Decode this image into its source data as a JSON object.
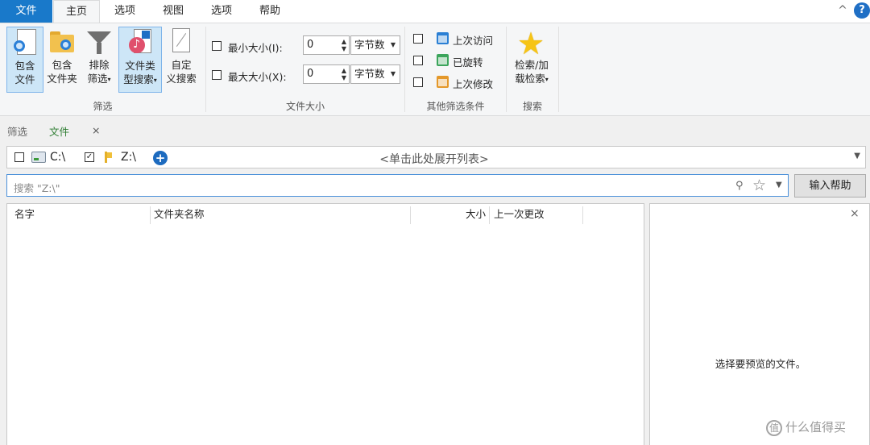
{
  "menu": {
    "file": "文件",
    "tabs": [
      "主页",
      "选项",
      "视图",
      "选项",
      "帮助"
    ],
    "collapse_glyph": "^",
    "help_glyph": "?"
  },
  "ribbon": {
    "filter_group": {
      "label": "筛选",
      "buttons": [
        {
          "line1": "包含",
          "line2": "文件",
          "icon": "document-search-icon"
        },
        {
          "line1": "包含",
          "line2": "文件夹",
          "icon": "folder-search-icon"
        },
        {
          "line1": "排除",
          "line2": "筛选",
          "icon": "funnel-icon"
        },
        {
          "line1": "文件类",
          "line2": "型搜索",
          "icon": "music-file-icon"
        },
        {
          "line1": "自定",
          "line2": "义搜索",
          "icon": "blank-document-icon"
        }
      ]
    },
    "size_group": {
      "label": "文件大小",
      "min_label": "最小大小(I):",
      "max_label": "最大大小(X):",
      "min_value": "0",
      "max_value": "0",
      "unit": "字节数"
    },
    "other_group": {
      "label": "其他筛选条件",
      "items": [
        "上次访问",
        "已旋转",
        "上次修改"
      ]
    },
    "search_group": {
      "label": "搜索",
      "line1": "检索/加",
      "line2": "载检索"
    }
  },
  "filter_tabs": {
    "filter": "筛选",
    "file": "文件",
    "close": "×"
  },
  "path_bar": {
    "drive_c": "C:\\",
    "drive_z": "Z:\\",
    "drive_c_checked": false,
    "drive_z_checked": true,
    "expand_text": "<单击此处展开列表>"
  },
  "search": {
    "placeholder": "搜索 \"Z:\\\"",
    "help_button": "输入帮助"
  },
  "results": {
    "columns": [
      "名字",
      "文件夹名称",
      "大小",
      "上一次更改"
    ]
  },
  "preview": {
    "close": "×",
    "message": "选择要预览的文件。"
  },
  "watermark": {
    "glyph": "值",
    "text": "什么值得买"
  },
  "colors": {
    "accent": "#1979ca",
    "selected_bg": "#cde6f7",
    "search_border": "#4a90d9",
    "active_tab_text": "#2e7d32"
  }
}
